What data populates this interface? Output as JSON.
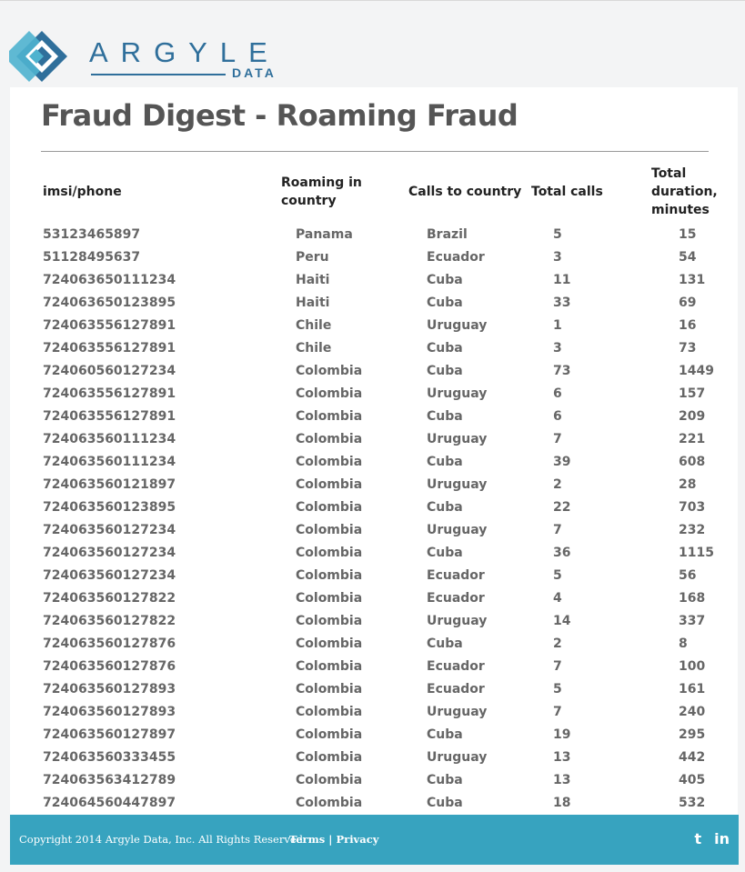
{
  "brand": {
    "name": "ARGYLE",
    "sub": "DATA"
  },
  "page": {
    "title": "Fraud Digest - Roaming Fraud"
  },
  "table": {
    "headers": {
      "imsi": "imsi/phone",
      "roaming": "Roaming in country",
      "calls_to": "Calls to country",
      "total_calls": "Total calls",
      "duration": "Total duration, minutes"
    },
    "rows": [
      [
        "53123465897",
        "Panama",
        "Brazil",
        "5",
        "15"
      ],
      [
        "51128495637",
        "Peru",
        "Ecuador",
        "3",
        "54"
      ],
      [
        "724063650111234",
        "Haiti",
        "Cuba",
        "11",
        "131"
      ],
      [
        "724063650123895",
        "Haiti",
        "Cuba",
        "33",
        "69"
      ],
      [
        "724063556127891",
        "Chile",
        "Uruguay",
        "1",
        "16"
      ],
      [
        "724063556127891",
        "Chile",
        "Cuba",
        "3",
        "73"
      ],
      [
        "724060560127234",
        "Colombia",
        "Cuba",
        "73",
        "1449"
      ],
      [
        "724063556127891",
        "Colombia",
        "Uruguay",
        "6",
        "157"
      ],
      [
        "724063556127891",
        "Colombia",
        "Cuba",
        "6",
        "209"
      ],
      [
        "724063560111234",
        "Colombia",
        "Uruguay",
        "7",
        "221"
      ],
      [
        "724063560111234",
        "Colombia",
        "Cuba",
        "39",
        "608"
      ],
      [
        "724063560121897",
        "Colombia",
        "Uruguay",
        "2",
        "28"
      ],
      [
        "724063560123895",
        "Colombia",
        "Cuba",
        "22",
        "703"
      ],
      [
        "724063560127234",
        "Colombia",
        "Uruguay",
        "7",
        "232"
      ],
      [
        "724063560127234",
        "Colombia",
        "Cuba",
        "36",
        "1115"
      ],
      [
        "724063560127234",
        "Colombia",
        "Ecuador",
        "5",
        "56"
      ],
      [
        "724063560127822",
        "Colombia",
        "Ecuador",
        "4",
        "168"
      ],
      [
        "724063560127822",
        "Colombia",
        "Uruguay",
        "14",
        "337"
      ],
      [
        "724063560127876",
        "Colombia",
        "Cuba",
        "2",
        "8"
      ],
      [
        "724063560127876",
        "Colombia",
        "Ecuador",
        "7",
        "100"
      ],
      [
        "724063560127893",
        "Colombia",
        "Ecuador",
        "5",
        "161"
      ],
      [
        "724063560127893",
        "Colombia",
        "Uruguay",
        "7",
        "240"
      ],
      [
        "724063560127897",
        "Colombia",
        "Cuba",
        "19",
        "295"
      ],
      [
        "724063560333455",
        "Colombia",
        "Uruguay",
        "13",
        "442"
      ],
      [
        "724063563412789",
        "Colombia",
        "Cuba",
        "13",
        "405"
      ],
      [
        "724064560447897",
        "Colombia",
        "Cuba",
        "18",
        "532"
      ]
    ]
  },
  "footer": {
    "copyright": "Copyright 2014 Argyle Data, Inc. All Rights Reserved.",
    "terms": "Terms",
    "separator": "|",
    "privacy": "Privacy",
    "social": {
      "twitter_icon": "twitter-icon",
      "linkedin_icon": "linkedin-icon",
      "twitter_glyph": "t",
      "linkedin_glyph": "in"
    }
  },
  "colors": {
    "brand": "#2f6f9b",
    "footer": "#37a3bf",
    "logo_light": "#4fb3cf",
    "logo_dark": "#2f6f9b"
  }
}
